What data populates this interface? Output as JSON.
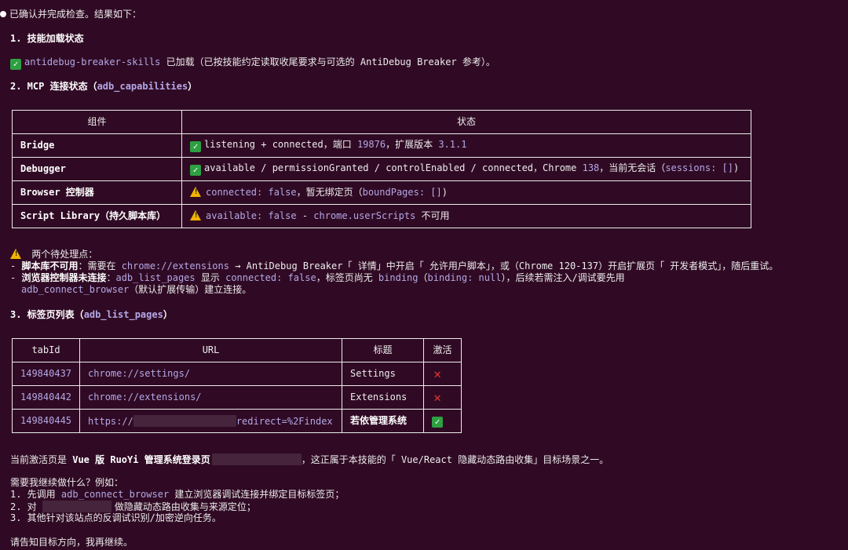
{
  "intro": "已确认并完成检查。结果如下：",
  "s1": {
    "title": "1. 技能加载状态",
    "skill_name": "antidebug-breaker-skills",
    "skill_text": " 已加载（已按技能约定读取收尾要求与可选的 AntiDebug Breaker 参考）。"
  },
  "s2": {
    "title_pre": "2. MCP 连接状态（",
    "title_code": "adb_capabilities",
    "title_post": "）",
    "headers": [
      "组件",
      "状态"
    ],
    "rows": [
      {
        "name": "Bridge",
        "parts": [
          [
            "t",
            "listening + connected，端口 "
          ],
          [
            "c",
            "19876"
          ],
          [
            "t",
            "，扩展版本 "
          ],
          [
            "c",
            "3.1.1"
          ]
        ],
        "icon": "check-icon"
      },
      {
        "name": "Debugger",
        "parts": [
          [
            "t",
            "available / permissionGranted / controlEnabled / connected，Chrome "
          ],
          [
            "c",
            "138"
          ],
          [
            "t",
            "，当前无会话（"
          ],
          [
            "c",
            "sessions: []"
          ],
          [
            "t",
            ")"
          ]
        ],
        "icon": "check-icon"
      },
      {
        "name": "Browser 控制器",
        "parts": [
          [
            "c",
            "connected: false"
          ],
          [
            "t",
            "，暂无绑定页（"
          ],
          [
            "c",
            "boundPages: []"
          ],
          [
            "t",
            ")"
          ]
        ],
        "icon": "warning-icon"
      },
      {
        "name": "Script Library（持久脚本库）",
        "parts": [
          [
            "c",
            "available: false"
          ],
          [
            "t",
            " - "
          ],
          [
            "c",
            "chrome.userScripts"
          ],
          [
            "t",
            " 不可用"
          ]
        ],
        "icon": "warning-icon"
      }
    ]
  },
  "pending": {
    "title": " 两个待处理点：",
    "line1_pre": "- ",
    "line1_bold": "脚本库不可用",
    "line1_a": "：需要在 ",
    "line1_code": "chrome://extensions",
    "line1_b": " → AntiDebug Breaker「 详情」中开启「 允许用户脚本」，或（Chrome 120-137）开启扩展页「 开发者模式」，随后重试。",
    "line2_pre": "- ",
    "line2_bold": "浏览器控制器未连接",
    "line2_a": "：",
    "line2_code1": "adb_list_pages",
    "line2_b": " 显示 ",
    "line2_code2": "connected: false",
    "line2_c": "，标签页尚无 ",
    "line2_code3": "binding",
    "line2_d": "（",
    "line2_code4": "binding: null",
    "line2_e": "），后续若需注入/调试要先用",
    "line3_code": "adb_connect_browser",
    "line3_text": "（默认扩展传输）建立连接。"
  },
  "s3": {
    "title_pre": "3. 标签页列表（",
    "title_code": "adb_list_pages",
    "title_post": "）",
    "headers": [
      "tabId",
      "URL",
      "标题",
      "激活"
    ],
    "rows": [
      {
        "tabId": "149840437",
        "url_pre": "chrome://settings/",
        "url_post": "",
        "title": "Settings",
        "active": "cross-icon"
      },
      {
        "tabId": "149840442",
        "url_pre": "chrome://extensions/",
        "url_post": "",
        "title": "Extensions",
        "active": "cross-icon"
      },
      {
        "tabId": "149840445",
        "url_pre": "https://",
        "url_post": "redirect=%2Findex",
        "title": "若依管理系统",
        "active": "check-icon"
      }
    ]
  },
  "current": {
    "pre": "当前激活页是 ",
    "bold": "Vue 版 RuoYi 管理系统登录页",
    "post": "，这正属于本技能的「 Vue/React 隐藏动态路由收集」目标场景之一。"
  },
  "next": {
    "q": "需要我继续做什么？例如：",
    "o1_pre": "1. 先调用 ",
    "o1_code": "adb_connect_browser",
    "o1_post": " 建立浏览器调试连接并绑定目标标签页；",
    "o2_pre": "2. 对 ",
    "o2_post": "做隐藏动态路由收集与来源定位；",
    "o3": "3. 其他针对该站点的反调试识别/加密逆向任务。"
  },
  "closing": "请告知目标方向，我再继续。"
}
